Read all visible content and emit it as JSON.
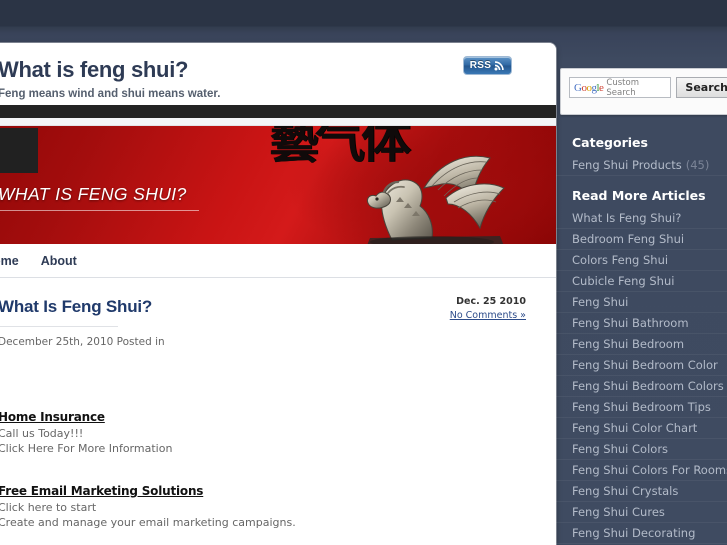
{
  "site": {
    "title": "What is feng shui?",
    "tagline": "Feng means wind and shui means water.",
    "rss_label": "RSS",
    "rss_icon": "rss-wave-icon"
  },
  "banner": {
    "title": "WHAT IS FENG SHUI?",
    "calligraphy": "藝气体",
    "image_alt": "silver-dragon-statue"
  },
  "nav": {
    "items": [
      {
        "label": "Home"
      },
      {
        "label": "About"
      }
    ]
  },
  "article": {
    "title": "What Is Feng Shui?",
    "date": "Dec. 25 2010",
    "comments": "No Comments »",
    "meta_line": "December 25th, 2010 Posted in"
  },
  "ads": [
    {
      "title": "Home Insurance",
      "lines": [
        "Call us Today!!!",
        "Click Here For More Information"
      ]
    },
    {
      "title": "Free Email Marketing Solutions",
      "lines": [
        "Click here to start",
        "Create and manage your email marketing campaigns."
      ]
    }
  ],
  "sidebar": {
    "search": {
      "logo_text": "Google",
      "logo_tm": "™",
      "placeholder": "Custom Search",
      "button_label": "Search"
    },
    "categories_heading": "Categories",
    "categories": [
      {
        "label": "Feng Shui Products",
        "count": "(45)"
      }
    ],
    "articles_heading": "Read More Articles",
    "articles": [
      {
        "label": "What Is Feng Shui?"
      },
      {
        "label": "Bedroom Feng Shui"
      },
      {
        "label": "Colors Feng Shui"
      },
      {
        "label": "Cubicle Feng Shui"
      },
      {
        "label": "Feng Shui"
      },
      {
        "label": "Feng Shui Bathroom"
      },
      {
        "label": "Feng Shui Bedroom"
      },
      {
        "label": "Feng Shui Bedroom Color"
      },
      {
        "label": "Feng Shui Bedroom Colors"
      },
      {
        "label": "Feng Shui Bedroom Tips"
      },
      {
        "label": "Feng Shui Color Chart"
      },
      {
        "label": "Feng Shui Colors"
      },
      {
        "label": "Feng Shui Colors For Rooms"
      },
      {
        "label": "Feng Shui Crystals"
      },
      {
        "label": "Feng Shui Cures"
      },
      {
        "label": "Feng Shui Decorating"
      }
    ]
  },
  "colors": {
    "page_background": "#3f4b61",
    "banner_red": "#c91414",
    "heading_navy": "#203a6b",
    "rss_blue": "#2f68a4",
    "sidebar_text": "#b3bbc9"
  }
}
